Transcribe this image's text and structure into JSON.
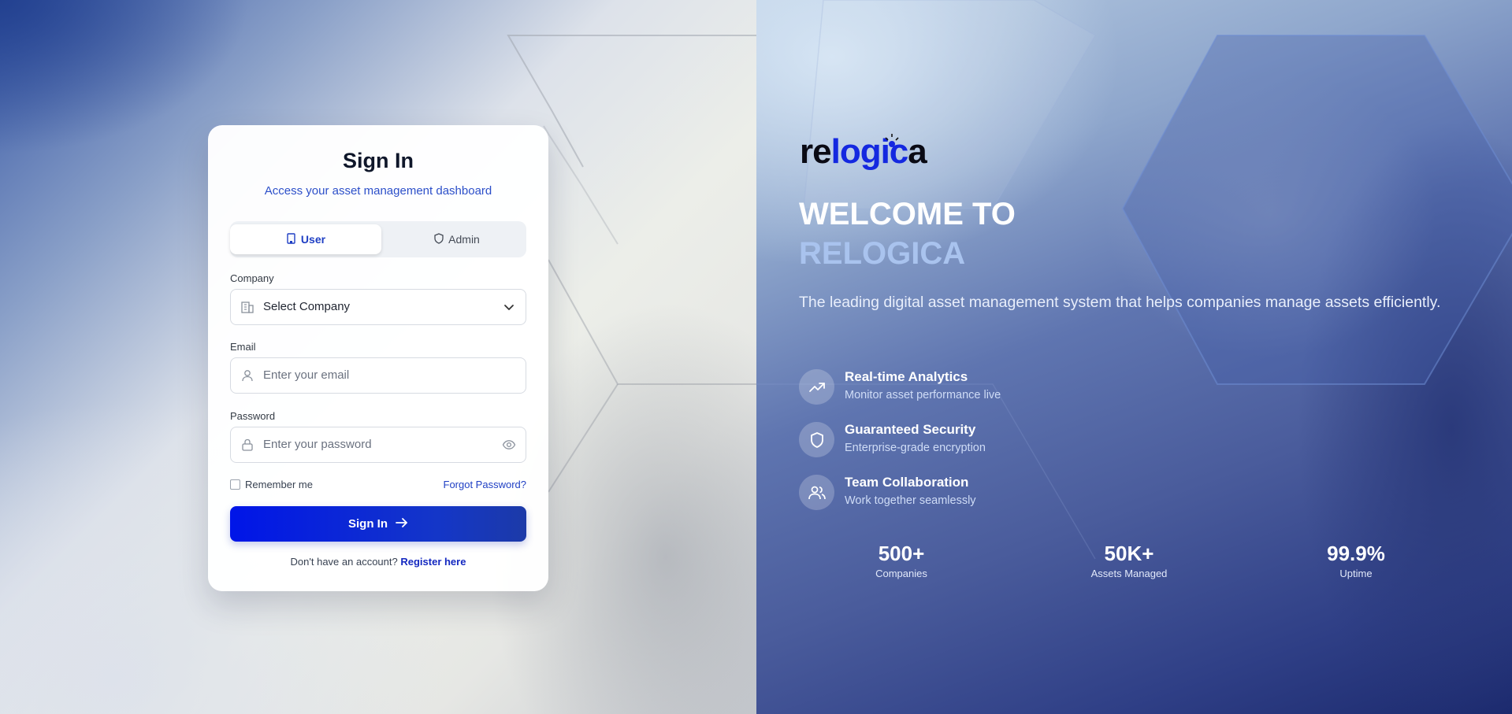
{
  "login": {
    "title": "Sign In",
    "subtitle": "Access your asset management dashboard",
    "tabs": [
      {
        "label": "User",
        "icon": "building-icon",
        "active": true
      },
      {
        "label": "Admin",
        "icon": "shield-icon",
        "active": false
      }
    ],
    "company": {
      "label": "Company",
      "value": "Select Company"
    },
    "email": {
      "label": "Email",
      "placeholder": "Enter your email"
    },
    "password": {
      "label": "Password",
      "placeholder": "Enter your password"
    },
    "remember_label": "Remember me",
    "forgot_label": "Forgot Password?",
    "submit_label": "Sign In",
    "register_prompt": "Don't have an account?",
    "register_link": "Register here"
  },
  "brand": {
    "logo_part1": "re",
    "logo_part2": "logic",
    "logo_part3": "a",
    "welcome_line1": "WELCOME TO",
    "welcome_line2": "RELOGICA",
    "tagline": "The leading digital asset management system that helps companies manage assets efficiently."
  },
  "features": [
    {
      "title": "Real-time Analytics",
      "desc": "Monitor asset performance live",
      "icon": "trending-up-icon"
    },
    {
      "title": "Guaranteed Security",
      "desc": "Enterprise-grade encryption",
      "icon": "shield-icon"
    },
    {
      "title": "Team Collaboration",
      "desc": "Work together seamlessly",
      "icon": "users-icon"
    }
  ],
  "stats": [
    {
      "value": "500+",
      "label": "Companies"
    },
    {
      "value": "50K+",
      "label": "Assets Managed"
    },
    {
      "value": "99.9%",
      "label": "Uptime"
    }
  ],
  "colors": {
    "primary": "#0015e8",
    "accent_text": "#2c4fc9",
    "welcome_highlight": "#a9c3ee",
    "logo_dark": "#0a0a14",
    "logo_blue": "#1428e0"
  }
}
